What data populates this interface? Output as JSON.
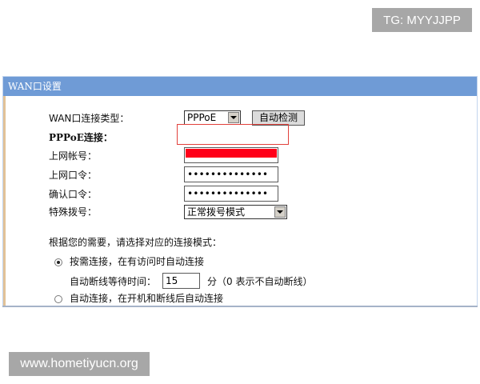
{
  "watermarks": {
    "top": "TG: MYYJJPP",
    "bottom": "www.hometiyucn.org"
  },
  "panel": {
    "title": "WAN口设置"
  },
  "wan_type": {
    "label": "WAN口连接类型：",
    "selected": "PPPoE",
    "detect_button": "自动检测"
  },
  "pppoe": {
    "section_label": "PPPoE连接：",
    "account_label": "上网帐号：",
    "account_value": "",
    "password_label": "上网口令：",
    "password_value": "••••••••••••••",
    "confirm_label": "确认口令：",
    "confirm_value": "••••••••••••••",
    "dial_label": "特殊拨号：",
    "dial_selected": "正常拨号模式"
  },
  "mode": {
    "prompt": "根据您的需要，请选择对应的连接模式：",
    "option_on_demand": "按需连接，在有访问时自动连接",
    "idle_label": "自动断线等待时间：",
    "idle_value": "15",
    "idle_unit": "分（0 表示不自动断线）",
    "option_auto": "自动连接，在开机和断线后自动连接",
    "selected": "on_demand"
  },
  "colors": {
    "header": "#6f9bd6",
    "redaction": "#ff0019",
    "highlight": "#e2413c"
  }
}
